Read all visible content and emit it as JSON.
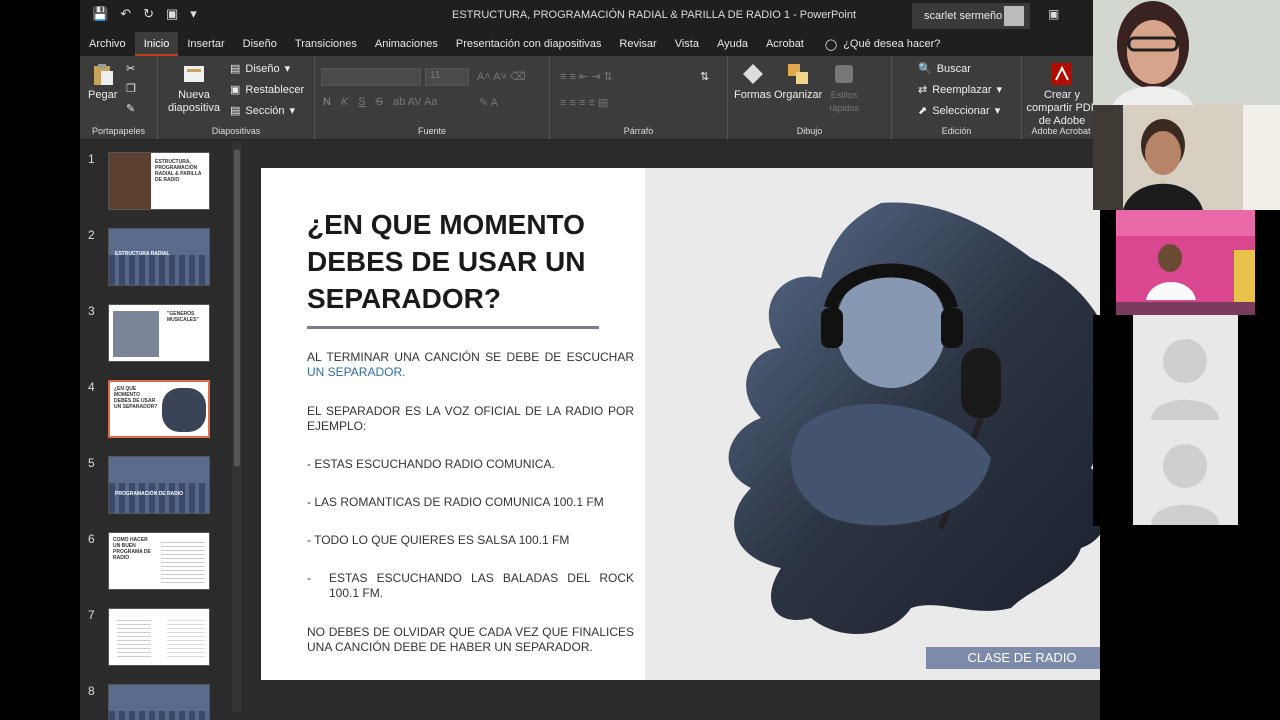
{
  "window": {
    "title": "ESTRUCTURA, PROGRAMACIÓN RADIAL & PARILLA DE RADIO 1 - PowerPoint",
    "user": "scarlet sermeño"
  },
  "tabs": [
    "Archivo",
    "Inicio",
    "Insertar",
    "Diseño",
    "Transiciones",
    "Animaciones",
    "Presentación con diapositivas",
    "Revisar",
    "Vista",
    "Ayuda",
    "Acrobat"
  ],
  "active_tab": "Inicio",
  "tell_me": "¿Qué desea hacer?",
  "ribbon": {
    "portapapeles": {
      "paste": "Pegar",
      "label": "Portapapeles"
    },
    "diapositivas": {
      "new_slide": "Nueva diapositiva",
      "layout": "Diseño",
      "reset": "Restablecer",
      "section": "Sección",
      "label": "Diapositivas"
    },
    "fuente": {
      "size": "11",
      "label": "Fuente"
    },
    "parrafo": {
      "label": "Párrafo"
    },
    "dibujo": {
      "shapes": "Formas",
      "arrange": "Organizar",
      "quick_styles": "Estilos rápidos",
      "label": "Dibujo"
    },
    "edicion": {
      "find": "Buscar",
      "replace": "Reemplazar",
      "select": "Seleccionar",
      "label": "Edición"
    },
    "acrobat": {
      "create": "Crear y compartir PDF de Adobe",
      "label": "Adobe Acrobat"
    }
  },
  "thumbnails": [
    {
      "num": "1",
      "text": "ESTRUCTURA, PROGRAMACIÓN RADIAL & PARILLA DE RADIO"
    },
    {
      "num": "2",
      "text": "ESTRUCTURA RADIAL"
    },
    {
      "num": "3",
      "text": "\"GENEROS MUSICALES\""
    },
    {
      "num": "4",
      "text": "¿EN QUE MOMENTO DEBES DE USAR UN SEPARADOR?"
    },
    {
      "num": "5",
      "text": "PROGRAMACIÓN DE RADIO"
    },
    {
      "num": "6",
      "text": "COMO HACER UN BUEN PROGRAMA DE RADIO"
    },
    {
      "num": "7",
      "text": ""
    },
    {
      "num": "8",
      "text": ""
    }
  ],
  "slide": {
    "title": "¿EN QUE MOMENTO DEBES DE USAR UN SEPARADOR?",
    "p1_a": "AL TERMINAR UNA CANCIÓN SE DEBE DE ESCUCHAR",
    "p1_b": "UN SEPARADOR.",
    "p2": "EL SEPARADOR ES LA VOZ OFICIAL DE LA RADIO POR EJEMPLO:",
    "b1": "- ESTAS ESCUCHANDO RADIO COMUNICA.",
    "b2": "- LAS ROMANTICAS DE RADIO COMUNICA 100.1 FM",
    "b3": "- TODO LO QUE QUIERES ES SALSA 100.1 FM",
    "b4_dash": "-",
    "b4": "ESTAS ESCUCHANDO LAS BALADAS DEL ROCK 100.1 FM.",
    "p3": "NO DEBES DE OLVIDAR QUE CADA VEZ QUE FINALICES UNA CANCIÓN DEBE DE HABER UN SEPARADOR.",
    "footer": "CLASE DE RADIO",
    "page": "4"
  },
  "colors": {
    "accent": "#2f6ea6",
    "footer_bg": "#7d8aa9",
    "tab_underline": "#c43e1c",
    "selected_thumb": "#e06c4a"
  }
}
